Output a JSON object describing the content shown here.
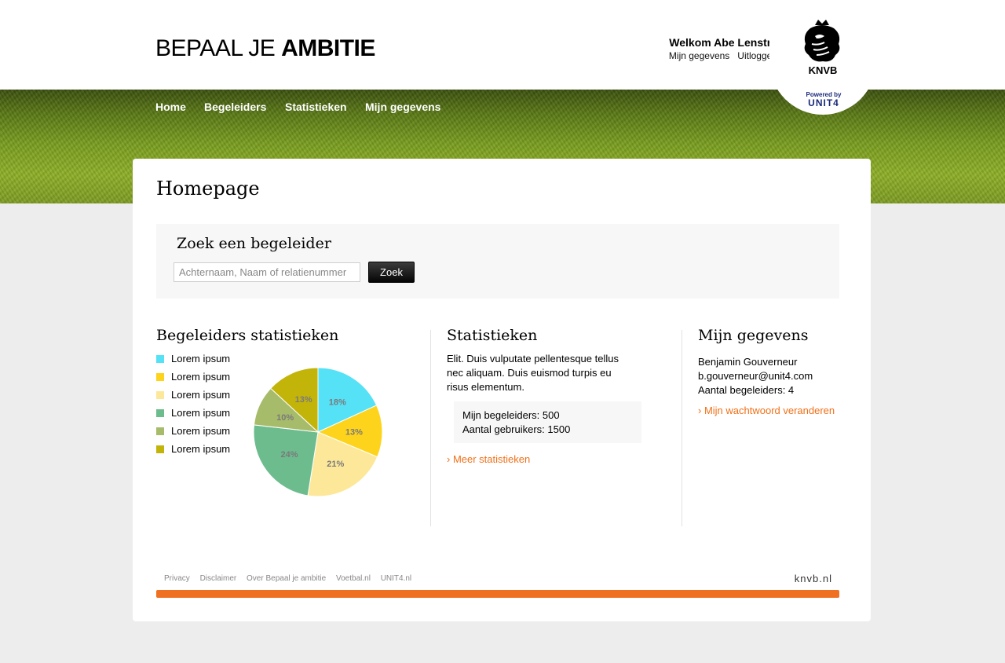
{
  "brand": {
    "light": "BEPAAL JE ",
    "bold": "AMBITIE"
  },
  "user": {
    "welcome": "Welkom Abe Lenstra",
    "links": [
      "Mijn gegevens",
      "Uitloggen"
    ]
  },
  "logo": {
    "name": "KNVB",
    "powered_by": "Powered by",
    "unit4": "UNIT4"
  },
  "nav": {
    "items": [
      {
        "label": "Home",
        "active": true
      },
      {
        "label": "Begeleiders",
        "active": false
      },
      {
        "label": "Statistieken",
        "active": false
      },
      {
        "label": "Mijn gegevens",
        "active": false
      }
    ]
  },
  "page": {
    "title": "Homepage"
  },
  "search": {
    "title": "Zoek een begeleider",
    "placeholder": "Achternaam, Naam of relatienummer",
    "button": "Zoek"
  },
  "begeleiders_stats": {
    "title": "Begeleiders statistieken",
    "legend": [
      {
        "label": "Lorem ipsum",
        "color": "#55e1f6"
      },
      {
        "label": "Lorem ipsum",
        "color": "#fed31b"
      },
      {
        "label": "Lorem ipsum",
        "color": "#fde89a"
      },
      {
        "label": "Lorem ipsum",
        "color": "#6cbc8e"
      },
      {
        "label": "Lorem ipsum",
        "color": "#a7bc6a"
      },
      {
        "label": "Lorem ipsum",
        "color": "#c3b40a"
      }
    ]
  },
  "chart_data": {
    "type": "pie",
    "slices": [
      {
        "label": "18%",
        "value": 18,
        "color": "#55e1f6"
      },
      {
        "label": "13%",
        "value": 13,
        "color": "#fed31b"
      },
      {
        "label": "21%",
        "value": 21,
        "color": "#fde89a"
      },
      {
        "label": "24%",
        "value": 24,
        "color": "#6cbc8e"
      },
      {
        "label": "10%",
        "value": 10,
        "color": "#a7bc6a"
      },
      {
        "label": "13%",
        "value": 13,
        "color": "#c3b40a"
      }
    ]
  },
  "statistieken": {
    "title": "Statistieken",
    "text_lines": [
      "Elit. Duis vulputate pellentesque tellus",
      "nec aliquam. Duis euismod turpis eu",
      "risus elementum."
    ],
    "mijn_begeleiders": "Mijn begeleiders: 500",
    "aantal_gebruikers": "Aantal gebruikers: 1500",
    "link": "› Meer statistieken"
  },
  "mijn_gegevens": {
    "title": "Mijn gegevens",
    "name": "Benjamin Gouverneur",
    "email": "b.gouverneur@unit4.com",
    "aantal": "Aantal begeleiders: 4",
    "link": "› Mijn wachtwoord veranderen"
  },
  "footer": {
    "links": [
      "Privacy",
      "Disclaimer",
      "Over Bepaal je ambitie",
      "Voetbal.nl",
      "UNIT4.nl"
    ],
    "right": "knvb.nl",
    "accent": "#f07022"
  }
}
